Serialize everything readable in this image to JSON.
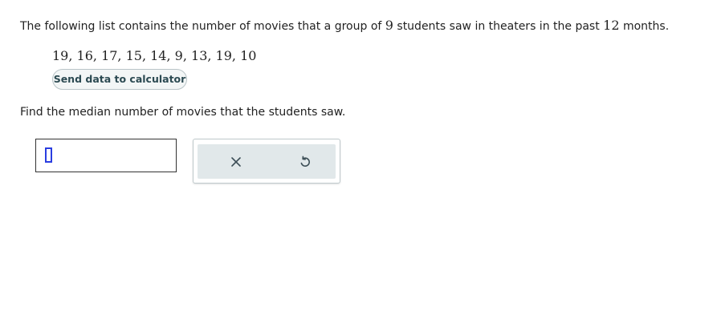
{
  "question": {
    "text_before": "The following list contains the number of movies that a group of ",
    "count": "9",
    "text_middle": " students saw in theaters in the past ",
    "months": "12",
    "text_after": " months."
  },
  "data_list": "19, 16, 17, 15, 14, 9, 13, 19, 10",
  "send_button_label": "Send data to calculator",
  "prompt": "Find the median number of movies that the students saw.",
  "answer": {
    "value": ""
  },
  "tools": {
    "clear_icon": "x-icon",
    "undo_icon": "undo-icon",
    "icon_color": "#3d4f57"
  }
}
